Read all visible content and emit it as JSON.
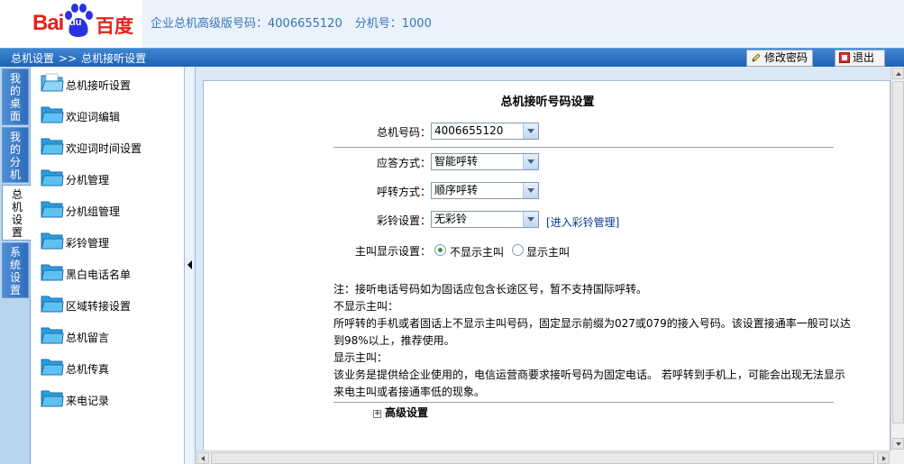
{
  "brand": {
    "logo_left": "Bai",
    "logo_mid": "du",
    "logo_right": "百度"
  },
  "header": {
    "plan_label": "企业总机高级版号码：",
    "plan_number": "4006655120",
    "ext_label": "分机号：",
    "ext_number": "1000"
  },
  "breadcrumb": {
    "root": "总机设置",
    "separator": ">>",
    "current": "总机接听设置"
  },
  "toolbar": {
    "change_password": "修改密码",
    "logout": "退出"
  },
  "vtabs": [
    {
      "chars": [
        "我",
        "的",
        "桌",
        "面"
      ],
      "active": false
    },
    {
      "chars": [
        "我",
        "的",
        "分",
        "机"
      ],
      "active": false
    },
    {
      "chars": [
        "总",
        "机",
        "设",
        "置"
      ],
      "active": true
    },
    {
      "chars": [
        "系",
        "统",
        "设",
        "置"
      ],
      "active": false
    }
  ],
  "menu": {
    "items": [
      {
        "label": "总机接听设置",
        "active": true
      },
      {
        "label": "欢迎词编辑"
      },
      {
        "label": "欢迎词时间设置"
      },
      {
        "label": "分机管理"
      },
      {
        "label": "分机组管理"
      },
      {
        "label": "彩铃管理"
      },
      {
        "label": "黑白电话名单"
      },
      {
        "label": "区域转接设置"
      },
      {
        "label": "总机留言"
      },
      {
        "label": "总机传真"
      },
      {
        "label": "来电记录"
      }
    ]
  },
  "form": {
    "title": "总机接听号码设置",
    "trunk_number_label": "总机号码：",
    "trunk_number_value": "4006655120",
    "answer_mode_label": "应答方式：",
    "answer_mode_value": "智能呼转",
    "forward_mode_label": "呼转方式：",
    "forward_mode_value": "顺序呼转",
    "ringback_label": "彩铃设置：",
    "ringback_value": "无彩铃",
    "ringback_link": "[进入彩铃管理]",
    "caller_display_label": "主叫显示设置：",
    "caller_display_options": [
      "不显示主叫",
      "显示主叫"
    ],
    "caller_display_selected": "不显示主叫"
  },
  "notes": [
    "注：接听电话号码如为固话应包含长途区号，暂不支持国际呼转。",
    "不显示主叫：",
    "所呼转的手机或者固话上不显示主叫号码，固定显示前缀为027或079的接入号码。该设置接通率一般可以达到98%以上，推荐使用。",
    "显示主叫：",
    "该业务是提供给企业使用的，电信运营商要求接听号码为固定电话。 若呼转到手机上，可能会出现无法显示来电主叫或者接通率低的现象。"
  ],
  "advanced": {
    "label": "高级设置"
  },
  "colors": {
    "brand_red": "#e2231a",
    "brand_blue": "#2932e1",
    "nav_blue": "#2f72c3",
    "header_text": "#3a73b5"
  }
}
